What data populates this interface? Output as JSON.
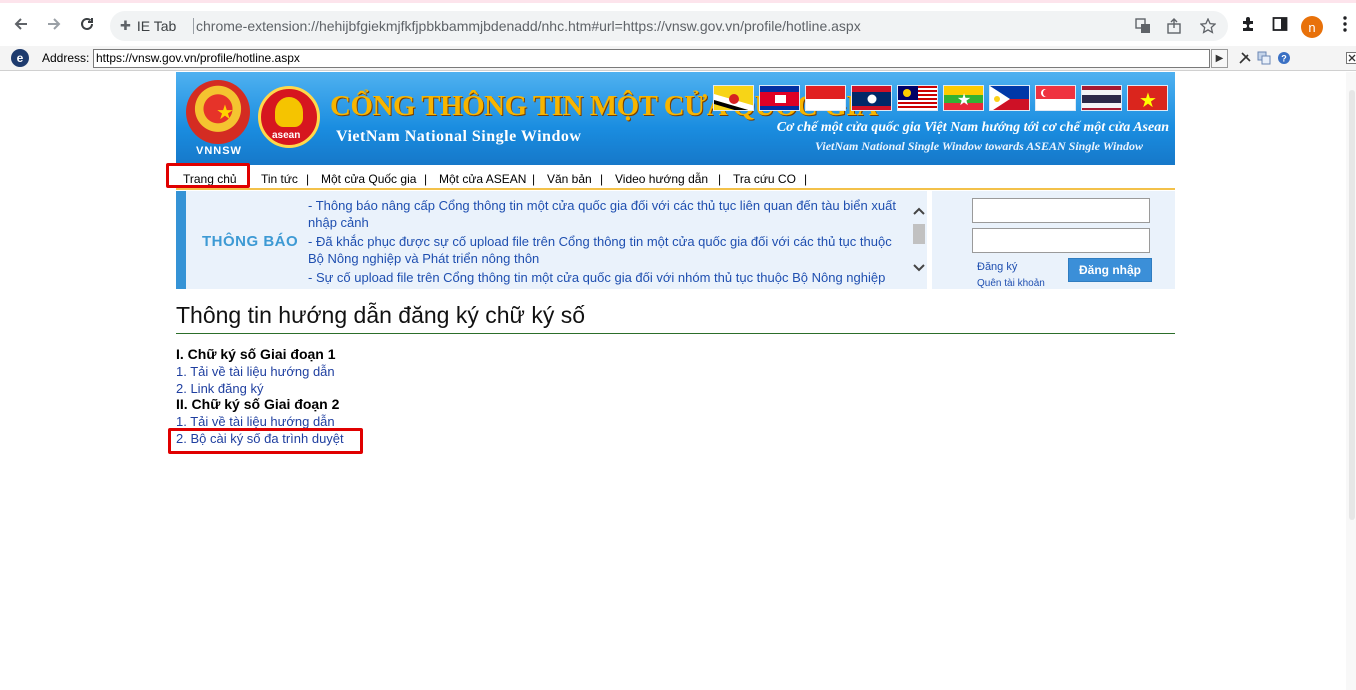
{
  "browser": {
    "ie_tab_label": "IE Tab",
    "url": "chrome-extension://hehijbfgiekmjfkfjpbkbammjbdenadd/nhc.htm#url=https://vnsw.gov.vn/profile/hotline.aspx",
    "avatar_letter": "n"
  },
  "ie_bar": {
    "address_label": "Address:",
    "address_value": "https://vnsw.gov.vn/profile/hotline.aspx"
  },
  "banner": {
    "logo_text": "VNNSW",
    "asean_text": "asean",
    "title": "CỔNG THÔNG TIN MỘT CỬA QUỐC GIA",
    "subtitle": "VietNam National Single Window",
    "tagline": "Cơ chế một cửa quốc gia Việt Nam hướng tới cơ chế một cửa Asean",
    "tagline_en": "VietNam National Single Window towards ASEAN Single Window"
  },
  "menu": {
    "items": [
      "Trang chủ",
      "Tin tức",
      "Một cửa Quốc gia",
      "Một cửa ASEAN",
      "Văn bản",
      "Video hướng dẫn",
      "Tra cứu CO"
    ],
    "separator": "|"
  },
  "notice": {
    "title": "THÔNG BÁO",
    "items": [
      "- Thông báo nâng cấp Cổng thông tin một cửa quốc gia đối với các thủ tục liên quan đến tàu biển xuất nhập cảnh",
      "- Đã khắc phục được sự cố upload file trên Cổng thông tin một cửa quốc gia đối với các thủ tục thuộc Bộ Nông nghiệp và Phát triển nông thôn",
      "- Sự cố upload file trên Cổng thông tin một cửa quốc gia đối với nhóm thủ tục thuộc Bộ Nông nghiệp"
    ]
  },
  "login": {
    "register": "Đăng ký",
    "forgot": "Quên tài khoản",
    "login_button": "Đăng nhập"
  },
  "content": {
    "title": "Thông tin hướng dẫn đăng ký chữ ký số",
    "section1": "I. Chữ ký số Giai đoạn 1",
    "section1_links": [
      "1. Tải về tài liệu hướng dẫn",
      "2. Link đăng ký"
    ],
    "section2": "II. Chữ ký số Giai đoạn 2",
    "section2_links": [
      "1. Tải về tài liệu hướng dẫn",
      "2. Bộ cài ký số đa trình duyệt"
    ]
  },
  "colors": {
    "highlight": "#e00000",
    "link": "#1f3fa0",
    "banner_title": "#f7b500"
  }
}
